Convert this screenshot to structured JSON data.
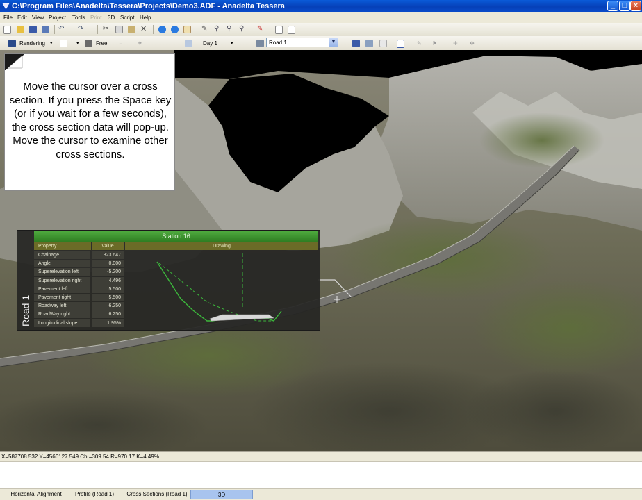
{
  "window": {
    "title": "C:\\Program Files\\Anadelta\\Tessera\\Projects\\Demo3.ADF - Anadelta Tessera",
    "minimize": "_",
    "maximize": "□",
    "close": "×"
  },
  "menu": [
    "File",
    "Edit",
    "View",
    "Project",
    "Tools",
    "Print",
    "3D",
    "Script",
    "Help"
  ],
  "toolbar2": {
    "rendering": "Rendering",
    "free": "Free",
    "day": "Day 1",
    "road_select": "Road 1"
  },
  "instruction": "Move the cursor over a cross section. If you press the Space key (or if you wait for a few seconds), the cross section data will pop-up. Move the cursor to examine other cross sections.",
  "station": {
    "title": "Station 16",
    "road_label": "Road 1",
    "headers": {
      "property": "Property",
      "value": "Value",
      "drawing": "Drawing"
    },
    "rows": [
      {
        "property": "Chainage",
        "value": "323.647"
      },
      {
        "property": "Angle",
        "value": "0.000"
      },
      {
        "property": "Superelevation left",
        "value": "-5.200"
      },
      {
        "property": "Superelevation right",
        "value": "4.496"
      },
      {
        "property": "Pavement left",
        "value": "5.500"
      },
      {
        "property": "Pavement right",
        "value": "5.500"
      },
      {
        "property": "Roadway left",
        "value": "6.250"
      },
      {
        "property": "RoadWay right",
        "value": "6.250"
      },
      {
        "property": "Longitudinal slope",
        "value": "1.95%"
      }
    ]
  },
  "status": "X=587708.532  Y=4566127.549  Ch.=309.54  R=970.17  K=4.49%",
  "tabs": [
    {
      "label": "Horizontal Alignment",
      "active": false
    },
    {
      "label": "Profile (Road 1)",
      "active": false
    },
    {
      "label": "Cross Sections (Road 1)",
      "active": false
    },
    {
      "label": "3D",
      "active": true
    }
  ],
  "colors": {
    "titlebar": "#0a5ad8",
    "station_header": "#3d9830",
    "active_tab": "#a8c4ee",
    "section_line": "#3cb83c"
  }
}
